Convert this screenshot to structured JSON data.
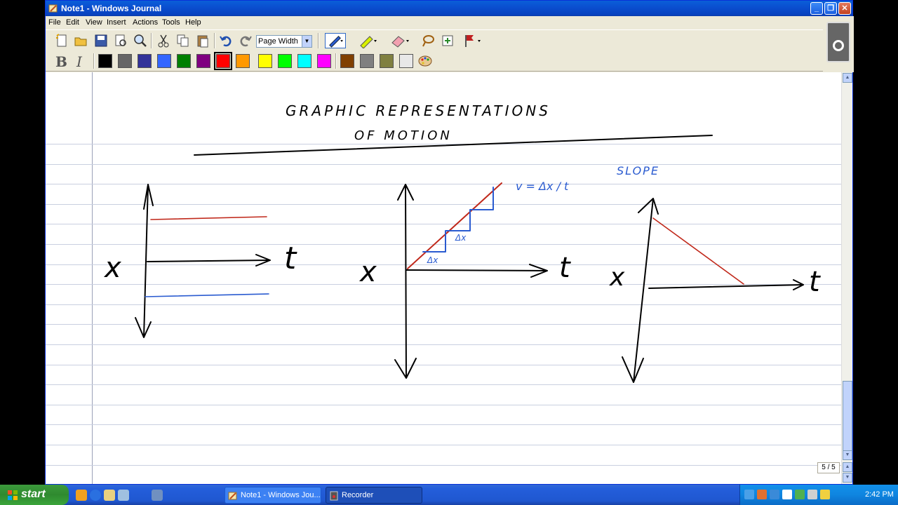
{
  "window": {
    "title": "Note1 - Windows Journal",
    "minimize_label": "_",
    "maximize_label": "❐",
    "close_label": "✕"
  },
  "menu": [
    "File",
    "Edit",
    "View",
    "Insert",
    "Actions",
    "Tools",
    "Help"
  ],
  "toolbar": {
    "zoom_value": "Page Width",
    "zoom_arrow": "▼",
    "bold_label": "B",
    "italic_label": "I",
    "icons": [
      "new-note-icon",
      "open-icon",
      "save-icon",
      "print-preview-icon",
      "find-icon",
      "cut-icon",
      "copy-icon",
      "paste-icon",
      "undo-icon",
      "redo-icon",
      "pen-icon",
      "highlighter-icon",
      "eraser-icon",
      "lasso-select-icon",
      "insert-space-icon",
      "flag-icon"
    ]
  },
  "colors": {
    "palette": [
      "#000000",
      "#666666",
      "#333399",
      "#3366ff",
      "#008000",
      "#800080",
      "#ff0000",
      "#ff9900",
      "#ffff00",
      "#00ff00",
      "#00ffff",
      "#ff00ff",
      "#804000",
      "#808080",
      "#808040",
      "#e8e8e8"
    ],
    "selected": "#ff0000",
    "ink_black": "#000000",
    "ink_red": "#c0281a",
    "ink_blue": "#2a5bd0",
    "rule_line": "#c9cfe0",
    "margin_line": "#9aa0b8"
  },
  "note": {
    "page_indicator": "5 / 5",
    "handwriting": {
      "title_line1": "GRAPHIC   REPRESENTATIONS",
      "title_line2": "OF   MOTION",
      "x_label_1": "x",
      "t_label_1": "t",
      "x_label_2": "x",
      "t_label_2": "t",
      "delta_x_1": "Δx",
      "delta_x_2": "Δx",
      "velocity_formula": "v = Δx / t",
      "slope_label": "SLOPE",
      "x_label_3": "x",
      "t_label_3": "t"
    }
  },
  "taskbar": {
    "start_label": "start",
    "items": [
      {
        "label": "Note1 - Windows Jou...",
        "active": false
      },
      {
        "label": "Recorder",
        "active": true
      }
    ],
    "clock": "2:42 PM"
  }
}
